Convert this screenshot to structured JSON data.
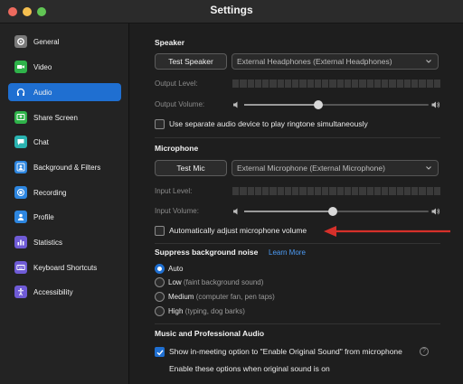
{
  "window": {
    "title": "Settings"
  },
  "sidebar": {
    "items": [
      {
        "label": "General",
        "icon": "gear-icon",
        "color": "#7a7a7a",
        "active": false
      },
      {
        "label": "Video",
        "icon": "video-camera-icon",
        "color": "#2fb34a",
        "active": false
      },
      {
        "label": "Audio",
        "icon": "headphones-icon",
        "color": "#1f6fd1",
        "active": true
      },
      {
        "label": "Share Screen",
        "icon": "share-screen-icon",
        "color": "#2fb34a",
        "active": false
      },
      {
        "label": "Chat",
        "icon": "chat-bubble-icon",
        "color": "#2ab3b1",
        "active": false
      },
      {
        "label": "Background & Filters",
        "icon": "person-background-icon",
        "color": "#2d86e0",
        "active": false
      },
      {
        "label": "Recording",
        "icon": "record-icon",
        "color": "#2d86e0",
        "active": false
      },
      {
        "label": "Profile",
        "icon": "person-icon",
        "color": "#2d86e0",
        "active": false
      },
      {
        "label": "Statistics",
        "icon": "bar-chart-icon",
        "color": "#6f5bd6",
        "active": false
      },
      {
        "label": "Keyboard Shortcuts",
        "icon": "keyboard-icon",
        "color": "#6f5bd6",
        "active": false
      },
      {
        "label": "Accessibility",
        "icon": "accessibility-icon",
        "color": "#6f5bd6",
        "active": false
      }
    ]
  },
  "speaker": {
    "title": "Speaker",
    "test_button": "Test Speaker",
    "device": "External Headphones (External Headphones)",
    "output_level_label": "Output Level:",
    "output_volume_label": "Output Volume:",
    "volume": 0.4,
    "separate_device_label": "Use separate audio device to play ringtone simultaneously",
    "separate_device_checked": false
  },
  "microphone": {
    "title": "Microphone",
    "test_button": "Test Mic",
    "device": "External Microphone (External Microphone)",
    "input_level_label": "Input Level:",
    "input_volume_label": "Input Volume:",
    "volume": 0.48,
    "auto_adjust_label": "Automatically adjust microphone volume",
    "auto_adjust_checked": false
  },
  "annotation": {
    "arrow_color": "#d6302a"
  },
  "noise": {
    "title": "Suppress background noise",
    "learn_more": "Learn More",
    "options": [
      {
        "label": "Auto",
        "desc": "",
        "selected": true
      },
      {
        "label": "Low",
        "desc": "(faint background sound)",
        "selected": false
      },
      {
        "label": "Medium",
        "desc": "(computer fan, pen taps)",
        "selected": false
      },
      {
        "label": "High",
        "desc": "(typing, dog barks)",
        "selected": false
      }
    ]
  },
  "music": {
    "title": "Music and Professional Audio",
    "original_sound_label": "Show in-meeting option to \"Enable Original Sound\" from microphone",
    "original_sound_checked": true,
    "hint": "Enable these options when original sound is on"
  }
}
